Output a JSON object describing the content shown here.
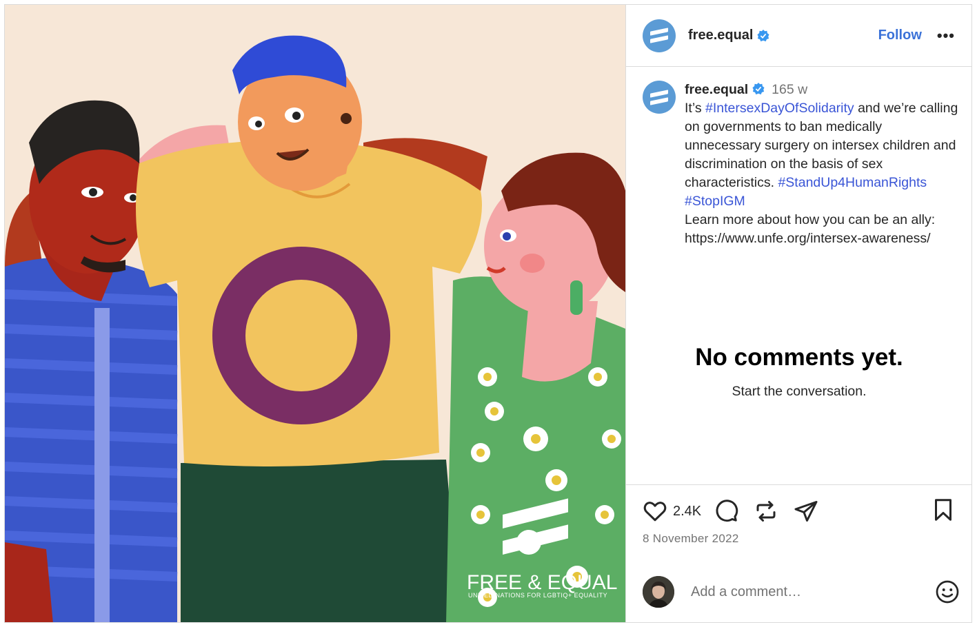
{
  "post": {
    "username": "free.equal",
    "follow_label": "Follow",
    "more_label": "•••",
    "caption": {
      "username": "free.equal",
      "time": "165 w",
      "p1": "It’s ",
      "tag1": "#IntersexDayOfSolidarity",
      "p2": " and we’re calling on governments to ban medically unnecessary surgery on intersex children and discrimination on the basis of sex characteristics.  ",
      "tag2": "#StandUp4HumanRights",
      "tag3": "#StopIGM",
      "p3": "Learn more about how you can be an ally: https://www.unfe.org/intersex-awareness/"
    },
    "empty_title": "No comments yet.",
    "empty_sub": "Start the conversation.",
    "likes": "2.4K",
    "date": "8 November 2022",
    "comment_placeholder": "Add a comment…"
  },
  "image": {
    "logo_line1": "FREE & EQUAL",
    "logo_line2": "UNITED NATIONS FOR LGBTIQ+ EQUALITY"
  },
  "icons": [
    "verified-badge-icon",
    "more-icon",
    "heart-icon",
    "comment-icon",
    "repost-icon",
    "share-icon",
    "bookmark-icon",
    "emoji-icon",
    "free-equal-logo-icon"
  ],
  "colors": {
    "accent_blue": "#3b72d8",
    "hashtag": "#3a55d6",
    "logo_blue": "#5b9bd5",
    "intersex_ring": "#7a2e64",
    "shirt_yellow": "#f2c45e"
  }
}
